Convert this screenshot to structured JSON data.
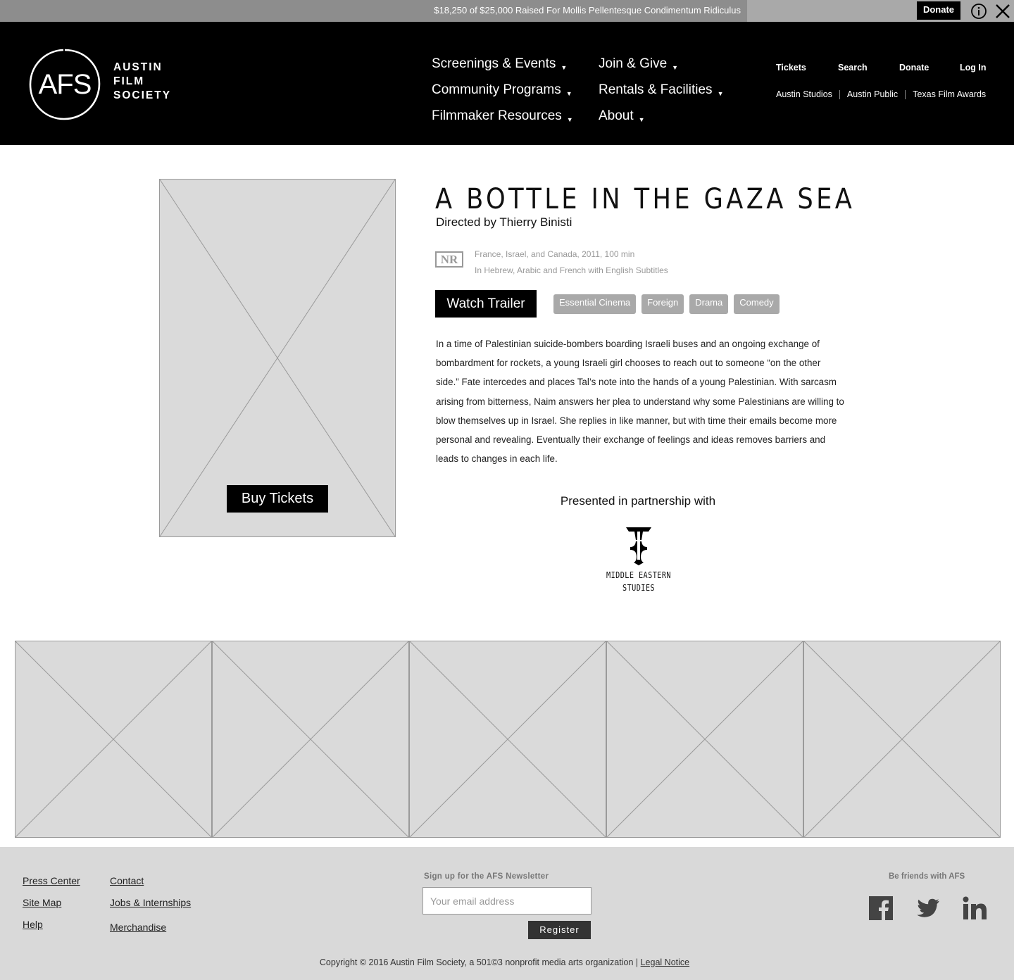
{
  "topbar": {
    "fundraising_text": "$18,250 of $25,000 Raised For Mollis Pellentesque Condimentum Ridiculus",
    "progress_fraction": 0.737,
    "donate_label": "Donate",
    "info_icon": "info-icon",
    "close_icon": "close-icon"
  },
  "header": {
    "logo": {
      "mark": "AFS",
      "line1": "AUSTIN",
      "line2": "FILM",
      "line3": "SOCIETY"
    },
    "nav_col1": [
      {
        "label": "Screenings & Events"
      },
      {
        "label": "Community Programs"
      },
      {
        "label": "Filmmaker Resources"
      }
    ],
    "nav_col2": [
      {
        "label": "Join & Give"
      },
      {
        "label": "Rentals & Facilities"
      },
      {
        "label": "About"
      }
    ],
    "utility": {
      "tickets": "Tickets",
      "search": "Search",
      "donate": "Donate",
      "login": "Log In"
    },
    "sublinks": [
      "Austin Studios",
      "Austin Public",
      "Texas Film Awards"
    ],
    "caret": "▼"
  },
  "film": {
    "title": "A BOTTLE IN THE GAZA SEA",
    "director": "Directed by Thierry Binisti",
    "rating": "NR",
    "meta_line1": "France, Israel, and Canada, 2011, 100 min",
    "meta_line2": "In Hebrew, Arabic and French with English Subtitles",
    "buy_label": "Buy Tickets",
    "trailer_label": "Watch Trailer",
    "tags": [
      "Essential Cinema",
      "Foreign",
      "Drama",
      "Comedy"
    ],
    "synopsis": "In a time of Palestinian suicide-bombers boarding Israeli buses and an ongoing exchange of bombardment for rockets, a young Israeli girl chooses to reach out to someone “on the other side.” Fate intercedes and places Tal’s note into the hands of a young Palestinian. With sarcasm arising from bitterness, Naim answers her plea to understand why some Palestinians are willing to blow themselves up in Israel. She replies in like manner, but with time their emails become more personal and revealing. Eventually their exchange of feelings and ideas removes barriers and leads to changes in each life.",
    "partner_label": "Presented in partnership with",
    "partner_name_line1": "MIDDLE EASTERN",
    "partner_name_line2": "STUDIES"
  },
  "gallery": {
    "count": 5
  },
  "footer": {
    "links_col1": [
      "Press Center",
      "Site Map",
      "Help"
    ],
    "links_col2": [
      "Contact",
      "Jobs & Internships",
      "Merchandise"
    ],
    "newsletter_label": "Sign up for the AFS Newsletter",
    "email_placeholder": "Your email address",
    "register_label": "Register",
    "friends_label": "Be friends with AFS",
    "social_icons": [
      "facebook-icon",
      "twitter-icon",
      "linkedin-icon"
    ],
    "copyright": "Copyright © 2016 Austin Film Society, a 501©3 nonprofit media arts organization  |",
    "legal_label": "Legal Notice"
  },
  "colors": {
    "header_bg": "#000000",
    "placeholder_gray": "#dadada",
    "tag_gray": "#a9a9a9",
    "footer_bg": "#d9d9d9"
  }
}
